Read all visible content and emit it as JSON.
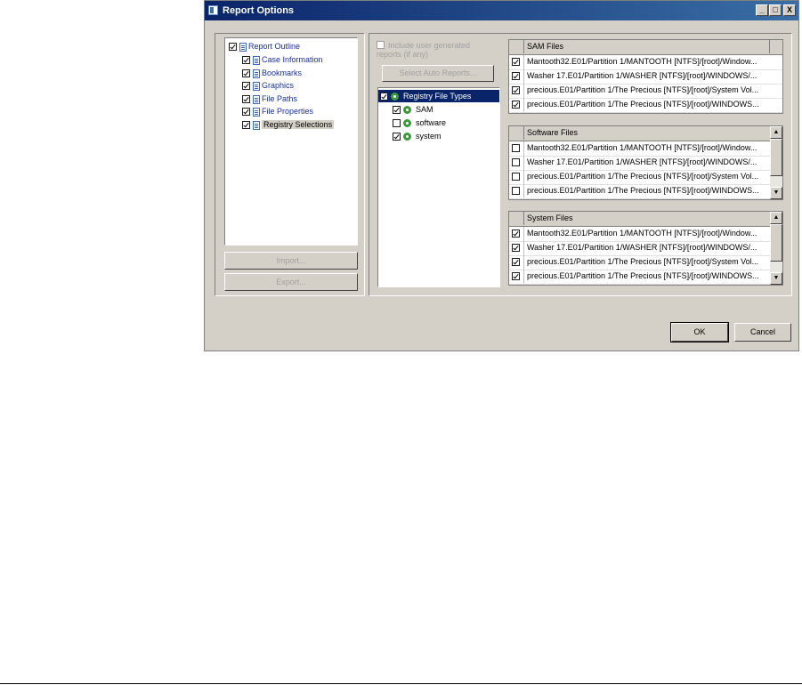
{
  "window": {
    "title": "Report Options",
    "minimize": "_",
    "maximize": "□",
    "close": "X"
  },
  "outline": {
    "items": [
      {
        "label": "Report Outline",
        "checked": true
      },
      {
        "label": "Case Information",
        "checked": true
      },
      {
        "label": "Bookmarks",
        "checked": true
      },
      {
        "label": "Graphics",
        "checked": true
      },
      {
        "label": "File Paths",
        "checked": true
      },
      {
        "label": "File Properties",
        "checked": true
      },
      {
        "label": "Registry Selections",
        "checked": true
      }
    ],
    "import_label": "Import...",
    "export_label": "Export..."
  },
  "middle": {
    "include_user_label": "Include user generated reports (if any)",
    "select_auto_label": "Select Auto Reports...",
    "registry_root": "Registry File Types",
    "registry_items": [
      {
        "label": "SAM",
        "checked": true
      },
      {
        "label": "software",
        "checked": false
      },
      {
        "label": "system",
        "checked": true
      }
    ]
  },
  "sam_files": {
    "header": "SAM Files",
    "rows": [
      {
        "path": "Mantooth32.E01/Partition 1/MANTOOTH [NTFS]/[root]/Window...",
        "checked": true
      },
      {
        "path": "Washer 17.E01/Partition 1/WASHER [NTFS]/[root]/WINDOWS/...",
        "checked": true
      },
      {
        "path": "precious.E01/Partition 1/The Precious [NTFS]/[root]/System Vol...",
        "checked": true
      },
      {
        "path": "precious.E01/Partition 1/The Precious [NTFS]/[root]/WINDOWS...",
        "checked": true
      }
    ]
  },
  "software_files": {
    "header": "Software Files",
    "rows": [
      {
        "path": "Mantooth32.E01/Partition 1/MANTOOTH [NTFS]/[root]/Window...",
        "checked": false
      },
      {
        "path": "Washer 17.E01/Partition 1/WASHER [NTFS]/[root]/WINDOWS/...",
        "checked": false
      },
      {
        "path": "precious.E01/Partition 1/The Precious [NTFS]/[root]/System Vol...",
        "checked": false
      },
      {
        "path": "precious.E01/Partition 1/The Precious [NTFS]/[root]/WINDOWS...",
        "checked": false
      }
    ]
  },
  "system_files": {
    "header": "System Files",
    "rows": [
      {
        "path": "Mantooth32.E01/Partition 1/MANTOOTH [NTFS]/[root]/Window...",
        "checked": true
      },
      {
        "path": "Washer 17.E01/Partition 1/WASHER [NTFS]/[root]/WINDOWS/...",
        "checked": true
      },
      {
        "path": "precious.E01/Partition 1/The Precious [NTFS]/[root]/System Vol...",
        "checked": true
      },
      {
        "path": "precious.E01/Partition 1/The Precious [NTFS]/[root]/WINDOWS...",
        "checked": true
      }
    ]
  },
  "footer": {
    "ok_label": "OK",
    "cancel_label": "Cancel"
  },
  "colors": {
    "titlebar_start": "#0a246a",
    "titlebar_end": "#3a6ea5",
    "dialog_bg": "#d4d0c8",
    "selection": "#0a246a"
  }
}
